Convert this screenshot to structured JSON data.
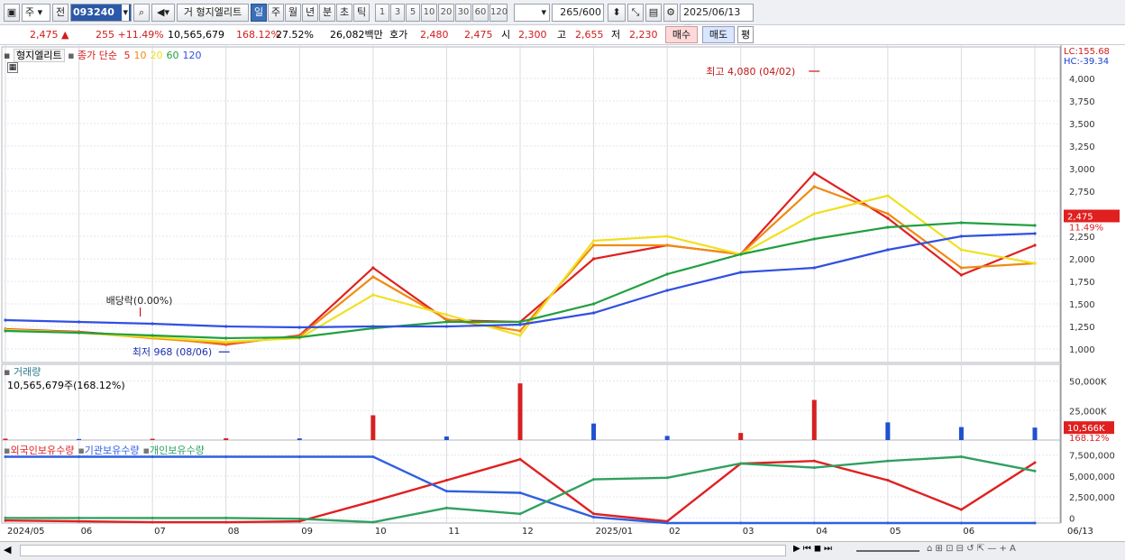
{
  "toolbar": {
    "market": "주",
    "prev": "전",
    "code": "093240",
    "trade_label": "거",
    "stock_name": "형지엘리트",
    "periods": [
      "일",
      "주",
      "월",
      "년",
      "분",
      "초",
      "틱"
    ],
    "active_period": "일",
    "minute_options": [
      "1",
      "3",
      "5",
      "10",
      "20",
      "30",
      "60",
      "120"
    ],
    "count_value": "265",
    "count_max": "/600",
    "date": "2025/06/13"
  },
  "info": {
    "price": "2,475",
    "change": "255",
    "change_pct": "+11.49%",
    "volume": "10,565,679",
    "volume_ratio": "168.12%",
    "turnover": "27.52%",
    "amount": "26,082백만",
    "bid_label": "호가",
    "bid_sell": "2,480",
    "bid_buy": "2,475",
    "open_label": "시",
    "open": "2,300",
    "high_label": "고",
    "high": "2,655",
    "low_label": "저",
    "low": "2,230",
    "buy_btn": "매수",
    "sell_btn": "매도",
    "avg_btn": "평"
  },
  "legend": {
    "name": "형지엘리트",
    "ma_label": "종가 단순",
    "ma_periods": [
      "5",
      "10",
      "20",
      "60",
      "120"
    ],
    "ma_colors": [
      "#e02020",
      "#f08a10",
      "#f0e020",
      "#20a040",
      "#3050e0"
    ],
    "lc": "LC:155.68",
    "hc": "HC:-39.34",
    "volume_title": "거래량",
    "volume_text": "10,565,679주(168.12%)",
    "holdings": [
      "외국인보유수량",
      "기관보유수량",
      "개인보유수량"
    ],
    "holding_colors": [
      "#e02020",
      "#3060e0",
      "#30a060"
    ]
  },
  "annotations": {
    "high": "최고 4,080 (04/02)",
    "low": "최저 968 (08/06)",
    "dividend": "배당락(0.00%)"
  },
  "price_axis": {
    "ticks": [
      {
        "v": 1000,
        "label": "1,000"
      },
      {
        "v": 1250,
        "label": "1,250"
      },
      {
        "v": 1500,
        "label": "1,500"
      },
      {
        "v": 1750,
        "label": "1,750"
      },
      {
        "v": 2000,
        "label": "2,000"
      },
      {
        "v": 2250,
        "label": "2,250"
      },
      {
        "v": 2500,
        "label": "2,500"
      },
      {
        "v": 2750,
        "label": "2,750"
      },
      {
        "v": 3000,
        "label": "3,000"
      },
      {
        "v": 3250,
        "label": "3,250"
      },
      {
        "v": 3500,
        "label": "3,500"
      },
      {
        "v": 3750,
        "label": "3,750"
      },
      {
        "v": 4000,
        "label": "4,000"
      }
    ],
    "current_label": "2,475",
    "current_pct": "11.49%",
    "current_value": 2475
  },
  "volume_axis": {
    "ticks": [
      {
        "v": 25000,
        "label": "25,000K"
      },
      {
        "v": 50000,
        "label": "50,000K"
      }
    ],
    "current_label": "10,566K",
    "current_pct": "168.12%",
    "current_value": 10566
  },
  "holding_axis": {
    "ticks": [
      {
        "v": 0,
        "label": "0"
      },
      {
        "v": 2500000,
        "label": "2,500,000"
      },
      {
        "v": 5000000,
        "label": "5,000,000"
      },
      {
        "v": 7500000,
        "label": "7,500,000"
      }
    ]
  },
  "x_labels": [
    "2024/05",
    "06",
    "07",
    "08",
    "09",
    "10",
    "11",
    "12",
    "2025/01",
    "02",
    "03",
    "04",
    "05",
    "06",
    "06/13"
  ],
  "chart_data": [
    {
      "type": "line",
      "title": "형지엘리트",
      "xlabel": "",
      "ylabel": "",
      "ylim": [
        850,
        4150
      ],
      "series": [
        {
          "name": "5",
          "color": "#e02020",
          "x": [
            "2024/05",
            "06",
            "07",
            "08",
            "09",
            "10",
            "11",
            "12",
            "2025/01",
            "02",
            "03",
            "04",
            "05",
            "06",
            "06/13"
          ],
          "values": [
            1220,
            1190,
            1130,
            1050,
            1150,
            1900,
            1320,
            1300,
            2000,
            2150,
            2050,
            2950,
            2450,
            1820,
            2150
          ]
        },
        {
          "name": "10",
          "color": "#f08a10",
          "x": [
            "2024/05",
            "06",
            "07",
            "08",
            "09",
            "10",
            "11",
            "12",
            "2025/01",
            "02",
            "03",
            "04",
            "05",
            "06",
            "06/13"
          ],
          "values": [
            1215,
            1185,
            1120,
            1060,
            1140,
            1800,
            1330,
            1200,
            2150,
            2150,
            2050,
            2800,
            2500,
            1900,
            1950
          ]
        },
        {
          "name": "20",
          "color": "#f0e020",
          "x": [
            "2024/05",
            "06",
            "07",
            "08",
            "09",
            "10",
            "11",
            "12",
            "2025/01",
            "02",
            "03",
            "04",
            "05",
            "06",
            "06/13"
          ],
          "values": [
            1210,
            1180,
            1130,
            1080,
            1120,
            1600,
            1380,
            1150,
            2200,
            2250,
            2050,
            2500,
            2700,
            2100,
            1950
          ]
        },
        {
          "name": "60",
          "color": "#20a040",
          "x": [
            "2024/05",
            "06",
            "07",
            "08",
            "09",
            "10",
            "11",
            "12",
            "2025/01",
            "02",
            "03",
            "04",
            "05",
            "06",
            "06/13"
          ],
          "values": [
            1200,
            1180,
            1150,
            1120,
            1130,
            1230,
            1300,
            1300,
            1500,
            1830,
            2050,
            2220,
            2350,
            2400,
            2370
          ]
        },
        {
          "name": "120",
          "color": "#3050e0",
          "x": [
            "2024/05",
            "06",
            "07",
            "08",
            "09",
            "10",
            "11",
            "12",
            "2025/01",
            "02",
            "03",
            "04",
            "05",
            "06",
            "06/13"
          ],
          "values": [
            1320,
            1300,
            1280,
            1250,
            1240,
            1250,
            1250,
            1270,
            1400,
            1650,
            1850,
            1900,
            2100,
            2250,
            2280
          ]
        }
      ],
      "annotations": [
        {
          "text": "최고 4,080 (04/02)",
          "x": "04/02",
          "y": 4080
        },
        {
          "text": "최저 968 (08/06)",
          "x": "08/06",
          "y": 968
        },
        {
          "text": "배당락(0.00%)"
        }
      ]
    },
    {
      "type": "bar",
      "title": "거래량",
      "ylabel": "",
      "ylim": [
        0,
        55000
      ],
      "categories": [
        "2024/05",
        "06",
        "07",
        "08",
        "09",
        "10",
        "11",
        "12",
        "2025/01",
        "02",
        "03",
        "04",
        "05",
        "06",
        "06/13"
      ],
      "values": [
        1200,
        900,
        1100,
        1500,
        1400,
        21000,
        3000,
        48000,
        14000,
        3500,
        6000,
        34000,
        15000,
        11000,
        10566
      ]
    },
    {
      "type": "line",
      "title": "",
      "ylim": [
        -600000,
        8000000
      ],
      "series": [
        {
          "name": "외국인보유수량",
          "color": "#e02020",
          "x": [
            "2024/05",
            "06",
            "07",
            "08",
            "09",
            "10",
            "11",
            "12",
            "2025/01",
            "02",
            "03",
            "04",
            "05",
            "06",
            "06/13"
          ],
          "values": [
            -300000,
            -400000,
            -500000,
            -500000,
            -400000,
            2000000,
            4500000,
            7000000,
            500000,
            -400000,
            6500000,
            6800000,
            4500000,
            1000000,
            6600000
          ]
        },
        {
          "name": "기관보유수량",
          "color": "#3060e0",
          "x": [
            "2024/05",
            "06",
            "07",
            "08",
            "09",
            "10",
            "11",
            "12",
            "2025/01",
            "02",
            "03",
            "04",
            "05",
            "06",
            "06/13"
          ],
          "values": [
            7300000,
            7300000,
            7300000,
            7300000,
            7300000,
            7300000,
            3200000,
            3000000,
            100000,
            -600000,
            -600000,
            -600000,
            -600000,
            -600000,
            -600000
          ]
        },
        {
          "name": "개인보유수량",
          "color": "#30a060",
          "x": [
            "2024/05",
            "06",
            "07",
            "08",
            "09",
            "10",
            "11",
            "12",
            "2025/01",
            "02",
            "03",
            "04",
            "05",
            "06",
            "06/13"
          ],
          "values": [
            0,
            0,
            0,
            0,
            -100000,
            -500000,
            1200000,
            500000,
            4600000,
            4800000,
            6500000,
            6000000,
            6800000,
            7300000,
            5600000
          ]
        }
      ]
    }
  ]
}
